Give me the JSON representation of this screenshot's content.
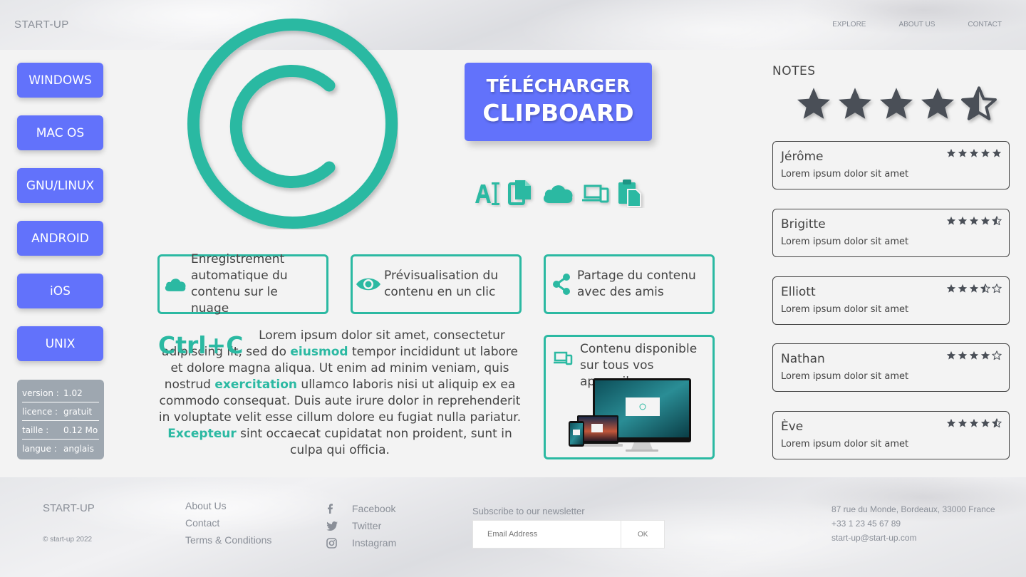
{
  "header": {
    "brand": "START-UP",
    "nav": [
      "EXPLORE",
      "ABOUT US",
      "CONTACT"
    ]
  },
  "os_buttons": [
    "WINDOWS",
    "MAC OS",
    "GNU/LINUX",
    "ANDROID",
    "iOS",
    "UNIX"
  ],
  "info": [
    {
      "label": "version :",
      "value": "1.02"
    },
    {
      "label": "licence :",
      "value": "gratuit"
    },
    {
      "label": "taille :",
      "value": "0.12 Mo"
    },
    {
      "label": "langue :",
      "value": "anglais"
    }
  ],
  "download": {
    "line1": "TÉLÉCHARGER",
    "line2": "CLIPBOARD"
  },
  "feature_icons": [
    "text-cursor-icon",
    "copy-icon",
    "cloud-icon",
    "devices-icon",
    "paste-icon"
  ],
  "features": {
    "cloud": "Enregistrement automatique du contenu sur le nuage",
    "preview": "Prévisualisation du contenu en un clic",
    "share": "Partage du contenu avec des amis",
    "devices": "Contenu disponible sur tous vos appareils"
  },
  "ctrl": {
    "title": "Ctrl+C",
    "p1": "Lorem ipsum dolor sit amet, consectetur adipiscing  lit, sed do ",
    "h1": "eiusmod",
    "p2": " tempor incididunt ut labore et dolore magna aliqua. Ut enim ad minim veniam, quis nostrud ",
    "h2": "exercitation",
    "p3": " ullamco laboris nisi ut aliquip ex ea commodo consequat. Duis aute irure dolor in reprehenderit in voluptate velit esse cillum dolore eu fugiat nulla pariatur. ",
    "h3": "Excepteur",
    "p4": " sint occaecat cupidatat non proident, sunt in culpa qui officia."
  },
  "notes": {
    "title": "NOTES",
    "overall_rating": 4.5,
    "reviews": [
      {
        "name": "Jérôme",
        "text": "Lorem ipsum dolor sit amet",
        "rating": 5
      },
      {
        "name": "Brigitte",
        "text": "Lorem ipsum dolor sit amet",
        "rating": 4.5
      },
      {
        "name": "Elliott",
        "text": "Lorem ipsum dolor sit amet",
        "rating": 3.5
      },
      {
        "name": "Nathan",
        "text": "Lorem ipsum dolor sit amet",
        "rating": 4
      },
      {
        "name": "Ève",
        "text": "Lorem ipsum dolor sit amet",
        "rating": 4.5
      }
    ]
  },
  "footer": {
    "brand": "START-UP",
    "copyright": "© start-up 2022",
    "links": [
      "About Us",
      "Contact",
      "Terms & Conditions"
    ],
    "social": [
      {
        "icon": "facebook-icon",
        "label": "Facebook"
      },
      {
        "icon": "twitter-icon",
        "label": "Twitter"
      },
      {
        "icon": "instagram-icon",
        "label": "Instagram"
      }
    ],
    "newsletter_title": "Subscribe to our newsletter",
    "email_placeholder": "Email Address",
    "ok_label": "OK",
    "address": "87 rue du Monde, Bordeaux, 33000 France",
    "phone": "+33 1 23 45 67 89",
    "email": "start-up@start-up.com"
  },
  "colors": {
    "accent": "#2bb9a2",
    "button": "#6272fb",
    "star": "#4a4f57"
  }
}
